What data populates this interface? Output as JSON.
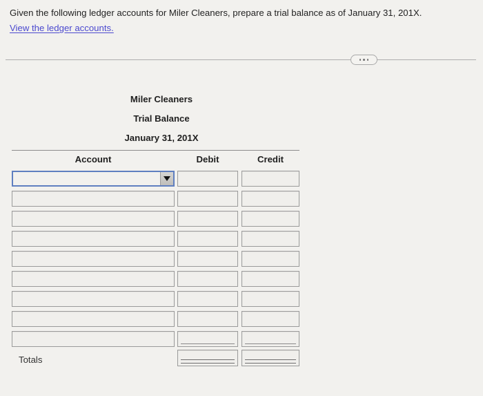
{
  "prompt": {
    "question": "Given the following ledger accounts for Miler Cleaners, prepare a trial balance as of January 31, 201X.",
    "link_label": "View the ledger accounts.",
    "link_color": "#4b49cf"
  },
  "divider": {
    "more_options_label": "..."
  },
  "worksheet": {
    "company_name": "Miler Cleaners",
    "statement_title": "Trial Balance",
    "statement_date": "January 31, 201X",
    "columns": [
      "Account",
      "Debit",
      "Credit"
    ],
    "rows": [
      {
        "account": "",
        "debit": "",
        "credit": "",
        "control": "dropdown",
        "focused": true,
        "rule": "none"
      },
      {
        "account": "",
        "debit": "",
        "credit": "",
        "control": "text",
        "focused": false,
        "rule": "none"
      },
      {
        "account": "",
        "debit": "",
        "credit": "",
        "control": "text",
        "focused": false,
        "rule": "none"
      },
      {
        "account": "",
        "debit": "",
        "credit": "",
        "control": "text",
        "focused": false,
        "rule": "none"
      },
      {
        "account": "",
        "debit": "",
        "credit": "",
        "control": "text",
        "focused": false,
        "rule": "none"
      },
      {
        "account": "",
        "debit": "",
        "credit": "",
        "control": "text",
        "focused": false,
        "rule": "none"
      },
      {
        "account": "",
        "debit": "",
        "credit": "",
        "control": "text",
        "focused": false,
        "rule": "none"
      },
      {
        "account": "",
        "debit": "",
        "credit": "",
        "control": "text",
        "focused": false,
        "rule": "none"
      },
      {
        "account": "",
        "debit": "",
        "credit": "",
        "control": "text",
        "focused": false,
        "rule": "single"
      }
    ],
    "totals": {
      "label": "Totals",
      "debit": "",
      "credit": "",
      "rule": "double"
    },
    "focus_border_color": "#5f7fc0"
  }
}
